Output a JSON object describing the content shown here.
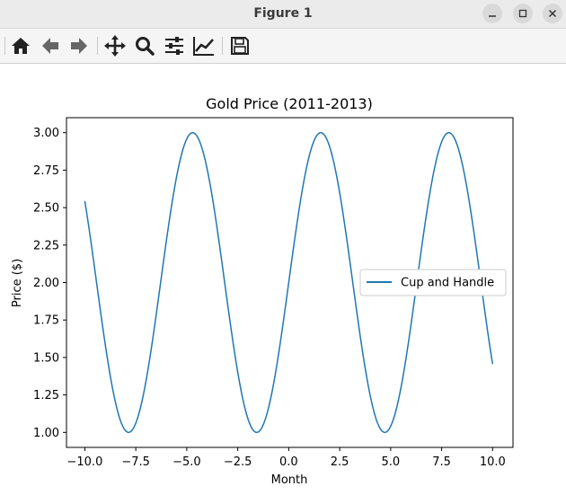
{
  "window": {
    "title": "Figure 1",
    "buttons": {
      "minimize_icon": "minimize-icon",
      "maximize_icon": "maximize-icon",
      "close_icon": "close-icon"
    }
  },
  "toolbar": {
    "items": [
      {
        "name": "home-button",
        "icon": "home-icon"
      },
      {
        "name": "back-button",
        "icon": "arrow-left-icon"
      },
      {
        "name": "forward-button",
        "icon": "arrow-right-icon"
      },
      {
        "name": "pan-button",
        "icon": "move-icon"
      },
      {
        "name": "zoom-button",
        "icon": "magnifier-icon"
      },
      {
        "name": "subplots-button",
        "icon": "sliders-icon"
      },
      {
        "name": "customize-button",
        "icon": "line-chart-icon"
      },
      {
        "name": "save-button",
        "icon": "save-icon"
      }
    ]
  },
  "chart_data": {
    "type": "line",
    "title": "Gold Price (2011-2013)",
    "xlabel": "Month",
    "ylabel": "Price ($)",
    "xlim": [
      -10.9,
      11.0
    ],
    "ylim": [
      0.9,
      3.1
    ],
    "xticks": [
      -10.0,
      -7.5,
      -5.0,
      -2.5,
      0.0,
      2.5,
      5.0,
      7.5,
      10.0
    ],
    "xtick_labels": [
      "−10.0",
      "−7.5",
      "−5.0",
      "−2.5",
      "0.0",
      "2.5",
      "5.0",
      "7.5",
      "10.0"
    ],
    "yticks": [
      1.0,
      1.25,
      1.5,
      1.75,
      2.0,
      2.25,
      2.5,
      2.75,
      3.0
    ],
    "ytick_labels": [
      "1.00",
      "1.25",
      "1.50",
      "1.75",
      "2.00",
      "2.25",
      "2.50",
      "2.75",
      "3.00"
    ],
    "legend": {
      "position": "center-right",
      "entries": [
        "Cup and Handle"
      ]
    },
    "series": [
      {
        "name": "Cup and Handle",
        "color": "#1f77b4",
        "x_range": [
          -10.0,
          10.0
        ],
        "x_step": 0.05,
        "formula": "y = sin(x) + 2"
      }
    ],
    "grid": false
  }
}
